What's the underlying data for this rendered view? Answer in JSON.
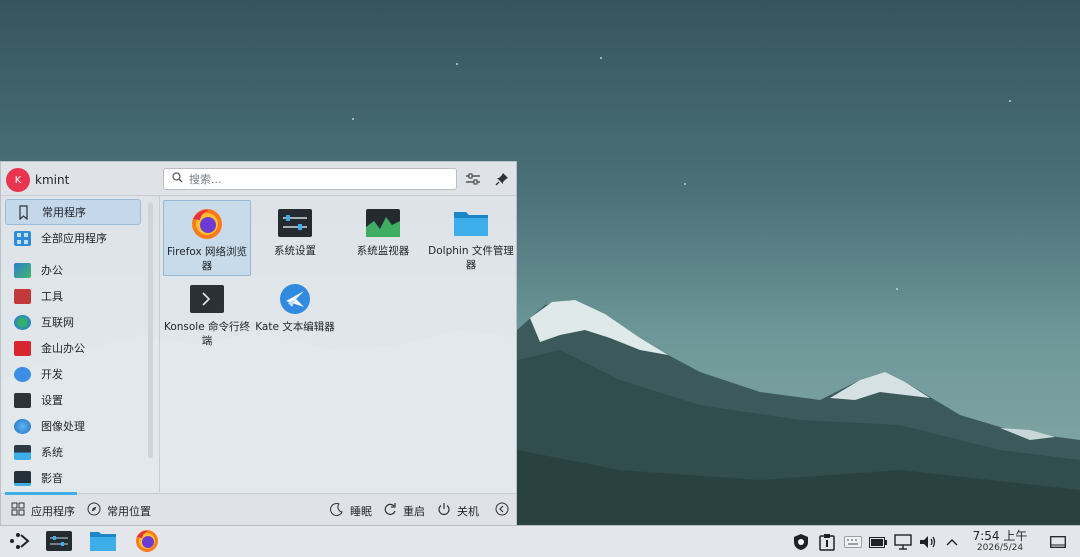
{
  "user": {
    "initial": "K",
    "name": "kmint"
  },
  "search": {
    "placeholder": "搜索..."
  },
  "sidebar": {
    "items": [
      {
        "label": "常用程序",
        "icon": "bookmark-icon"
      },
      {
        "label": "全部应用程序",
        "icon": "all-apps-icon"
      },
      {
        "label": "办公",
        "icon": "office-icon"
      },
      {
        "label": "工具",
        "icon": "toolbox-icon"
      },
      {
        "label": "互联网",
        "icon": "globe-icon"
      },
      {
        "label": "金山办公",
        "icon": "wps-icon"
      },
      {
        "label": "开发",
        "icon": "development-icon"
      },
      {
        "label": "设置",
        "icon": "settings-icon"
      },
      {
        "label": "图像处理",
        "icon": "graphics-icon"
      },
      {
        "label": "系统",
        "icon": "system-icon"
      },
      {
        "label": "影音",
        "icon": "multimedia-icon"
      }
    ]
  },
  "apps": [
    {
      "label": "Firefox 网络浏览器",
      "icon": "firefox-icon"
    },
    {
      "label": "系统设置",
      "icon": "system-settings-icon"
    },
    {
      "label": "系统监视器",
      "icon": "system-monitor-icon"
    },
    {
      "label": "Dolphin 文件管理器",
      "icon": "folder-icon"
    },
    {
      "label": "Konsole 命令行终端",
      "icon": "terminal-icon"
    },
    {
      "label": "Kate 文本编辑器",
      "icon": "kate-icon"
    }
  ],
  "footer": {
    "applications": "应用程序",
    "places": "常用位置",
    "sleep": "睡眠",
    "restart": "重启",
    "shutdown": "关机"
  },
  "clock": {
    "time": "7:54 上午",
    "date": "2026/5/24"
  },
  "colors": {
    "accent": "#3daee9",
    "avatar": "#e8344f",
    "highlight": "#c7dbea"
  }
}
